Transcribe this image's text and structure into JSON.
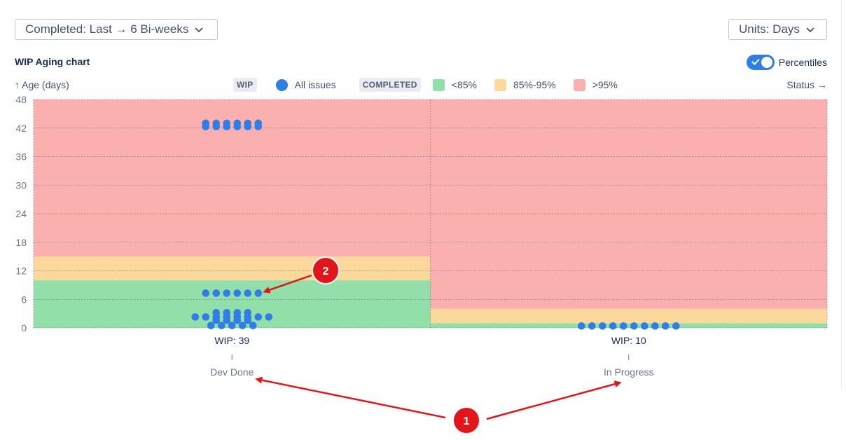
{
  "controls": {
    "completed_dropdown": "Completed: Last → 6 Bi-weeks",
    "units_dropdown": "Units: Days",
    "percentiles_toggle_label": "Percentiles",
    "percentiles_enabled": true
  },
  "legend": {
    "wip_tag": "WIP",
    "all_issues": "All issues",
    "completed_tag": "COMPLETED",
    "p85": "<85%",
    "p85_95": "85%-95%",
    "p95": ">95%"
  },
  "colors": {
    "issue_dot": "#2f7ee8",
    "band_p85": "#93dfaa",
    "band_p85_95": "#fdd89b",
    "band_p95": "#f9b0af",
    "toggle_on": "#2f7ee8",
    "annotation": "#e3151a"
  },
  "chart_data": {
    "type": "scatter",
    "title": "WIP Aging chart",
    "ylabel": "↑ Age (days)",
    "xlabel": "Status →",
    "ylim": [
      0,
      48
    ],
    "yticks": [
      "0",
      "6",
      "12",
      "18",
      "24",
      "30",
      "36",
      "42",
      "48"
    ],
    "grid": true,
    "legend_position": "top-center",
    "categories": [
      {
        "name": "Dev Done",
        "wip_label": "WIP: 39",
        "p85": 10,
        "p95": 15,
        "issue_ages": [
          43,
          43,
          43,
          43,
          43,
          43,
          42.3,
          42.3,
          42.3,
          42.3,
          42.3,
          42.3,
          7.3,
          7.3,
          7.3,
          7.3,
          7.3,
          7.3,
          3.2,
          3.2,
          3.2,
          3.2,
          2.3,
          2.3,
          2.3,
          2.3,
          2.3,
          2.3,
          2.3,
          2.3,
          1.6,
          1.6,
          1.6,
          1.6,
          0.5,
          0.5,
          0.5,
          0.5,
          0.5
        ]
      },
      {
        "name": "In Progress",
        "wip_label": "WIP: 10",
        "p85": 1,
        "p95": 4,
        "issue_ages": [
          0.4,
          0.4,
          0.4,
          0.4,
          0.4,
          0.4,
          0.4,
          0.4,
          0.4,
          0.4
        ]
      }
    ]
  },
  "annotations": [
    {
      "label": "1"
    },
    {
      "label": "2"
    }
  ]
}
